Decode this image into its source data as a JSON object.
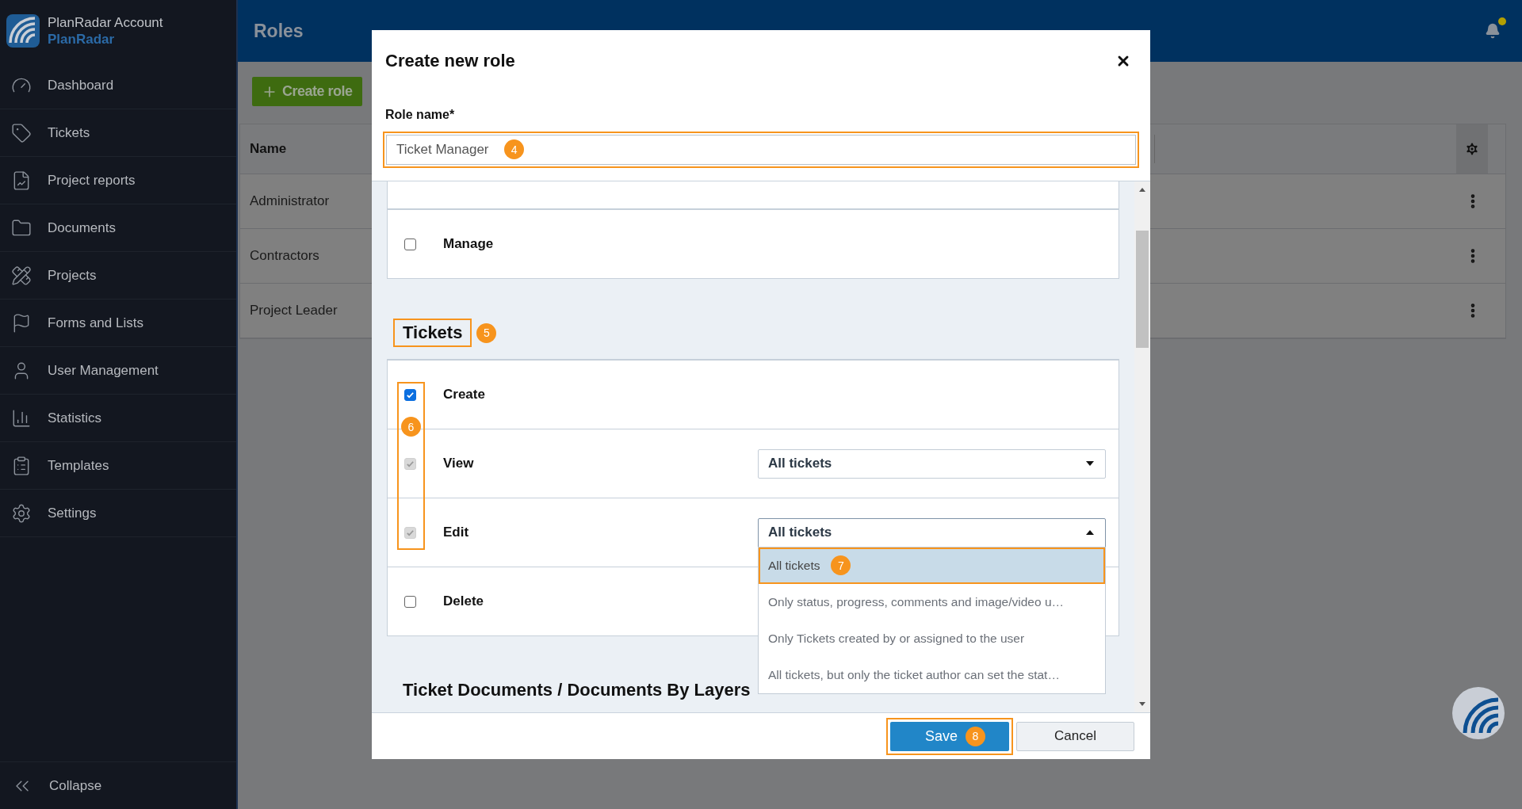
{
  "sidebar": {
    "account": "PlanRadar Account",
    "brand": "PlanRadar",
    "items": [
      {
        "label": "Dashboard"
      },
      {
        "label": "Tickets"
      },
      {
        "label": "Project reports"
      },
      {
        "label": "Documents"
      },
      {
        "label": "Projects"
      },
      {
        "label": "Forms and Lists"
      },
      {
        "label": "User Management"
      },
      {
        "label": "Statistics"
      },
      {
        "label": "Templates"
      },
      {
        "label": "Settings"
      }
    ],
    "collapse": "Collapse"
  },
  "header": {
    "title": "Roles",
    "has_notification": true
  },
  "toolbar": {
    "create_button": "Create role"
  },
  "table": {
    "columns": [
      "Name"
    ],
    "rows": [
      "Administrator",
      "Contractors",
      "Project Leader"
    ]
  },
  "modal": {
    "title": "Create new role",
    "role_name": {
      "label": "Role name*",
      "value": "Ticket Manager",
      "callout": "4"
    },
    "sections": [
      {
        "rows": [
          {
            "label": "Manage",
            "checked": false,
            "disabled": false
          }
        ]
      },
      {
        "title": "Tickets",
        "callout": "5",
        "checkbox_callout": "6",
        "rows": [
          {
            "label": "Create",
            "checked": true,
            "disabled": false
          },
          {
            "label": "View",
            "checked": true,
            "disabled": true,
            "select": {
              "value": "All tickets",
              "open": false
            }
          },
          {
            "label": "Edit",
            "checked": true,
            "disabled": true,
            "select": {
              "value": "All tickets",
              "open": true,
              "options": [
                {
                  "label": "All tickets",
                  "selected": true,
                  "callout": "7"
                },
                {
                  "label": "Only status, progress, comments and image/video u…",
                  "selected": false
                },
                {
                  "label": "Only Tickets created by or assigned to the user",
                  "selected": false
                },
                {
                  "label": "All tickets, but only the ticket author can set the stat…",
                  "selected": false
                }
              ]
            }
          },
          {
            "label": "Delete",
            "checked": false,
            "disabled": false
          }
        ]
      },
      {
        "title": "Ticket Documents / Documents By Layers"
      }
    ],
    "footer": {
      "save": "Save",
      "save_callout": "8",
      "cancel": "Cancel"
    }
  }
}
